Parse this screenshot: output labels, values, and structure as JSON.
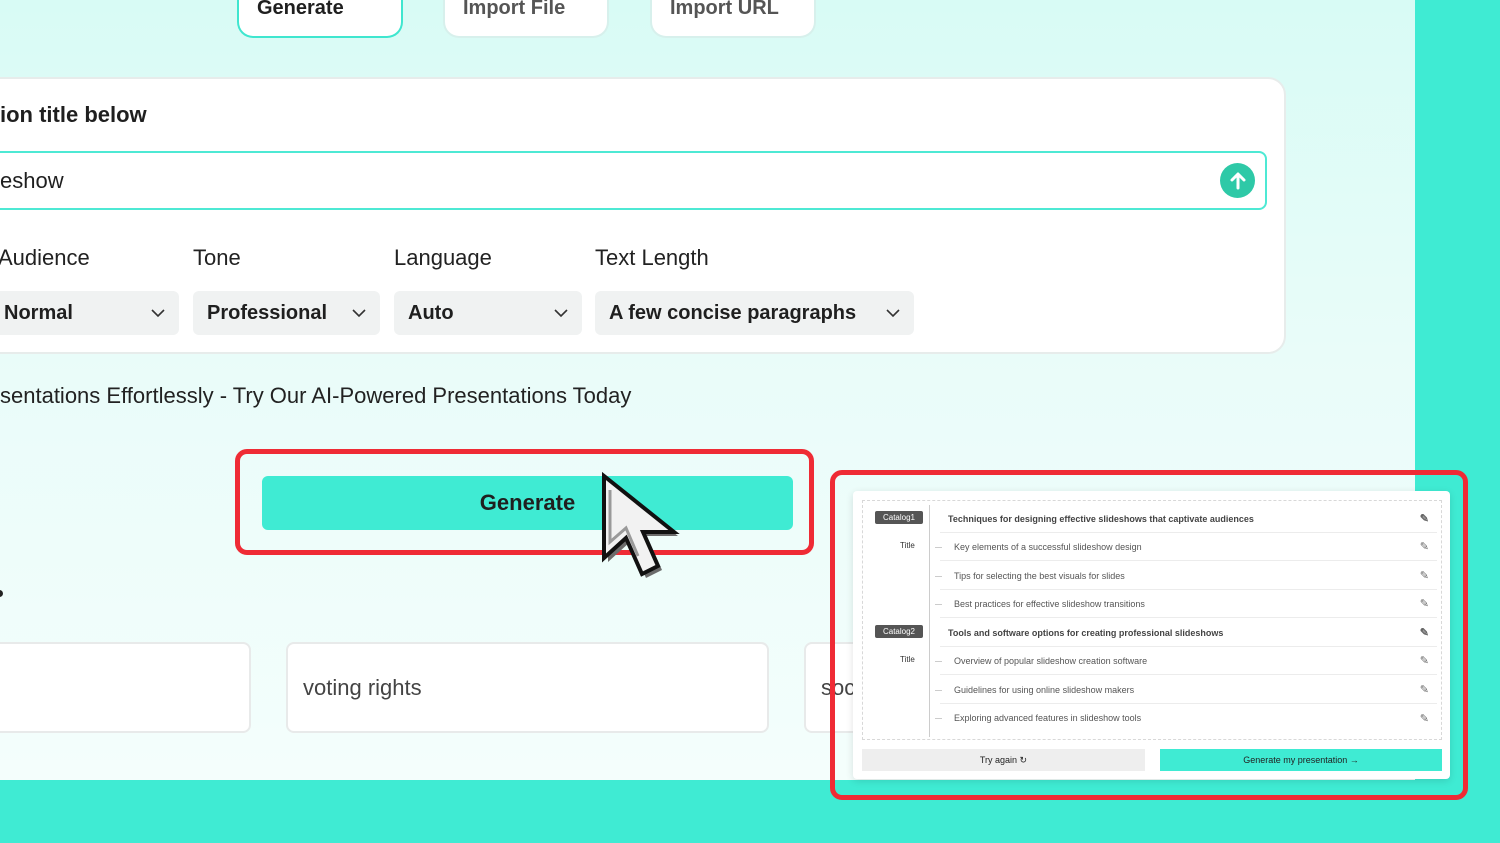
{
  "tabs": [
    {
      "label": "Generate",
      "active": true
    },
    {
      "label": "Import File",
      "active": false
    },
    {
      "label": "Import URL",
      "active": false
    }
  ],
  "card": {
    "heading": "ion title below",
    "title_input_value": "eshow",
    "send_icon": "arrow-up-icon"
  },
  "fields": [
    {
      "label": "Audience",
      "value": "Normal"
    },
    {
      "label": "Tone",
      "value": "Professional"
    },
    {
      "label": "Language",
      "value": "Auto"
    },
    {
      "label": "Text Length",
      "value": "A few concise paragraphs"
    }
  ],
  "tagline": "sentations Effortlessly - Try Our AI-Powered Presentations Today",
  "generate_label": "Generate",
  "suggestions": [
    "",
    "voting rights",
    "soc"
  ],
  "outline": {
    "sections": [
      {
        "catalog": "Catalog1",
        "title_tag": "Title",
        "heading": "Techniques for designing effective slideshows that captivate audiences",
        "items": [
          "Key elements of a successful slideshow design",
          "Tips for selecting the best visuals for slides",
          "Best practices for effective slideshow transitions"
        ]
      },
      {
        "catalog": "Catalog2",
        "title_tag": "Title",
        "heading": "Tools and software options for creating professional slideshows",
        "items": [
          "Overview of popular slideshow creation software",
          "Guidelines for using online slideshow makers",
          "Exploring advanced features in slideshow tools"
        ]
      }
    ],
    "try_again_label": "Try again ↻",
    "generate_presentation_label": "Generate my presentation →"
  },
  "colors": {
    "accent": "#3febd3",
    "highlight": "#ef2b35",
    "send_button": "#2ec9a7"
  }
}
